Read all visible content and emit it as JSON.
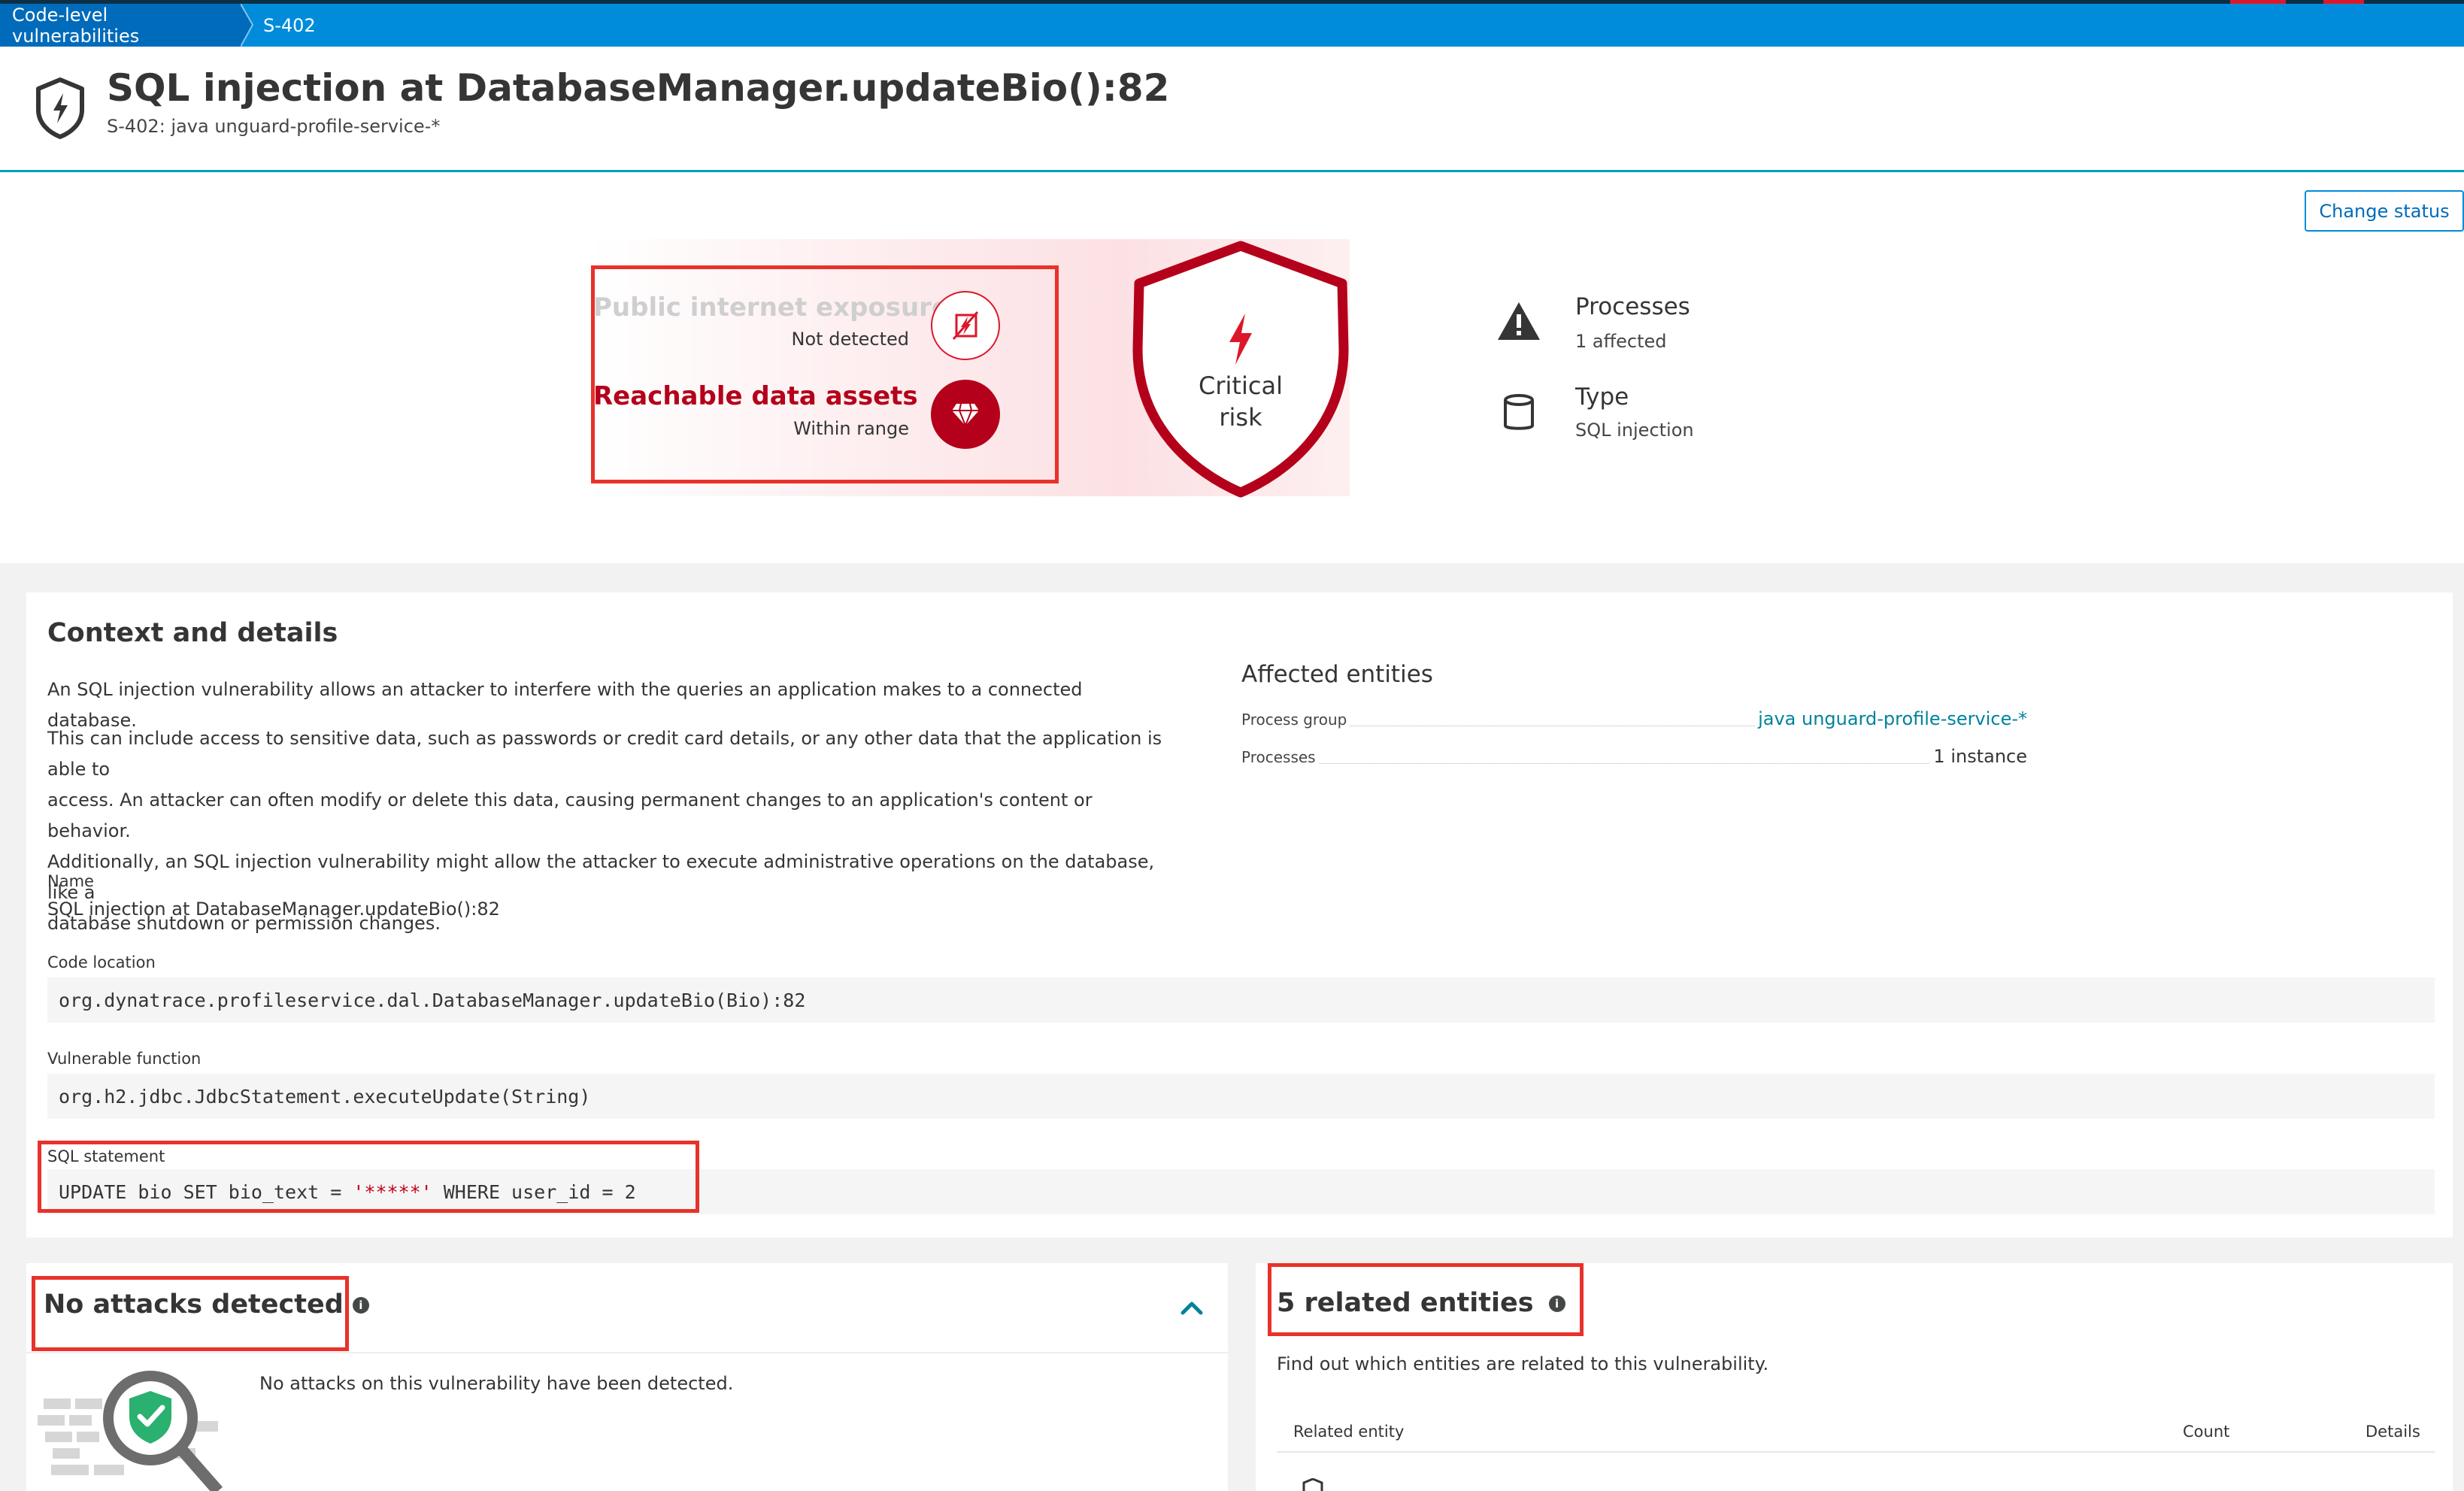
{
  "breadcrumb": {
    "items": [
      "Code-level vulnerabilities",
      "S-402"
    ]
  },
  "header": {
    "title": "SQL injection at DatabaseManager.updateBio():82",
    "subtitle": "S-402: java unguard-profile-service-*",
    "icon": "shield-lightning-icon"
  },
  "actions": {
    "change_status": "Change status"
  },
  "risk": {
    "public_exposure": {
      "title": "Public internet exposure",
      "value": "Not detected",
      "icon": "no-internet-icon"
    },
    "data_assets": {
      "title": "Reachable data assets",
      "value": "Within range",
      "icon": "gem-icon"
    },
    "level_line1": "Critical",
    "level_line2": "risk",
    "colors": {
      "critical": "#b4001a",
      "accent": "#dc172a"
    }
  },
  "meta": {
    "processes": {
      "title": "Processes",
      "value": "1 affected",
      "icon": "warning-icon"
    },
    "type": {
      "title": "Type",
      "value": "SQL injection",
      "icon": "database-icon"
    }
  },
  "context": {
    "heading": "Context and details",
    "para1": "An SQL injection vulnerability allows an attacker to interfere with the queries an application makes to a connected database.",
    "para2": [
      "This can include access to sensitive data, such as passwords or credit card details, or any other data that the application is able to",
      "access. An attacker can often modify or delete this data, causing permanent changes to an application's content or behavior.",
      "Additionally, an SQL injection vulnerability might allow the attacker to execute administrative operations on the database, like a",
      "database shutdown or permission changes."
    ],
    "name_label": "Name",
    "name_value": "SQL injection at DatabaseManager.updateBio():82",
    "code_location_label": "Code location",
    "code_location_value": "org.dynatrace.profileservice.dal.DatabaseManager.updateBio(Bio):82",
    "vulnerable_function_label": "Vulnerable function",
    "vulnerable_function_value": "org.h2.jdbc.JdbcStatement.executeUpdate(String)",
    "sql_label": "SQL statement",
    "sql_prefix": "UPDATE bio SET bio_text = ",
    "sql_masked": "'*****'",
    "sql_suffix": " WHERE user_id = 2"
  },
  "affected": {
    "heading": "Affected entities",
    "rows": [
      {
        "key": "Process group",
        "value": "java unguard-profile-service-*"
      },
      {
        "key": "Processes",
        "value": "1 instance"
      }
    ]
  },
  "attacks": {
    "title": "No attacks detected",
    "message": "No attacks on this vulnerability have been detected."
  },
  "related": {
    "title": "5 related entities",
    "description": "Find out which entities are related to this vulnerability.",
    "columns": [
      "Related entity",
      "Count",
      "Details"
    ]
  }
}
